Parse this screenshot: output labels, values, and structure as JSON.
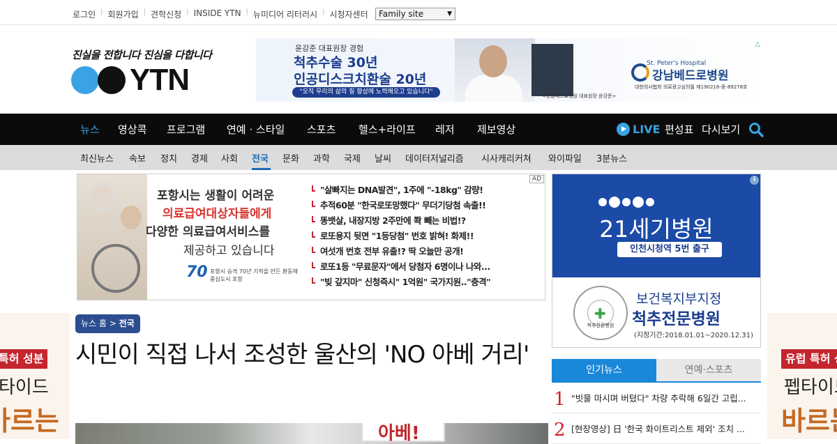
{
  "topbar": {
    "links": [
      "로그인",
      "회원가입",
      "견학신청",
      "INSIDE YTN",
      "뉴미디어 리터러시",
      "시청자센터"
    ],
    "family_site": "Family site"
  },
  "logo": {
    "slogan": "진실을 전합니다  진심을 다합니다",
    "text": "YTN"
  },
  "top_ad": {
    "kicker": "윤강준 대표원장 경험",
    "line1": "척추수술 30년",
    "line2": "인공디스크치환술 20년",
    "pill": "\"오직 우리의 삶의 질 향상에 노력해오고 있습니다\"",
    "caption": "<강남베드로병원 대표원장 윤강준>",
    "hospital_en": "St. Peter's Hospital",
    "hospital": "강남베드로병원",
    "hospital_sub": "대한의사협회 의료광고심의필 제190216-중-89278호"
  },
  "main_nav": {
    "items": [
      "뉴스",
      "영상콕",
      "프로그램",
      "연예 · 스타일",
      "스포츠",
      "헬스+라이프",
      "레저",
      "제보영상"
    ],
    "live": "LIVE",
    "schedule": "편성표",
    "replay": "다시보기"
  },
  "sub_nav": {
    "items": [
      "최신뉴스",
      "속보",
      "정치",
      "경제",
      "사회",
      "전국",
      "문화",
      "과학",
      "국제",
      "날씨",
      "데이터저널리즘",
      "시사캐리커쳐",
      "와이파일",
      "3분뉴스"
    ]
  },
  "mid_ad": {
    "ad_label": "AD",
    "copy": [
      "포항시는 생활이 어려운",
      "의료급여대상자들에게",
      "다양한 의료급여서비스를",
      "제공하고 있습니다"
    ],
    "emblem": "70",
    "emblem_sub": "포항시 승격 70년\n기적을 만든 환동해 중심도시 포항",
    "links": [
      "\"살빠지는 DNA발견\", 1주에 \"-18kg\" 감량!",
      "추적60분 \"한국로또망했다\" 무더기당첨 속출!!",
      "똥뱃살, 내장지방 2주만에 쫙 빼는 비법!?",
      "로또용지 뒷면 \"1등당첨\" 번호 밝혀! 화제!!",
      "여섯개 번호 전부 유출!? 딱 오늘만 공개!",
      "로또1등 \"무료문자\"에서 당첨자 6명이나 나와...",
      "\"빚 갚지마\" 신청즉시\" 1억원\" 국가지원..\"충격\""
    ]
  },
  "right_ad": {
    "name": "21세기병원",
    "exit": "인천시청역 5번 출구",
    "seal": "척추전문병원",
    "h1": "보건복지부지정",
    "h2": "척추전문병원",
    "h3": "(지정기간:2018.01.01~2020.12.31)"
  },
  "popular": {
    "tab_news": "인기뉴스",
    "tab_ent": "연예·스포츠",
    "items": [
      {
        "num": "1",
        "title": "\"빗물 마시며 버텼다\" 차량 추락해 6일간 고립..."
      },
      {
        "num": "2",
        "title": "[현장영상] 日 '한국 화이트리스트 제외' 조치 ..."
      }
    ]
  },
  "article": {
    "crumb_home": "뉴스 홈",
    "crumb_sep": ">",
    "crumb_section": "전국",
    "headline": "시민이 직접 나서 조성한 울산의 'NO 아베 거리'",
    "photo_sign": "아베!"
  },
  "edge_ads": {
    "left": {
      "tag": "특허 성분",
      "l2": "타이드",
      "l3": "바르는"
    },
    "right": {
      "tag": "유럽 특허 성",
      "l2": "펩타이드",
      "l3": "바르는"
    }
  }
}
